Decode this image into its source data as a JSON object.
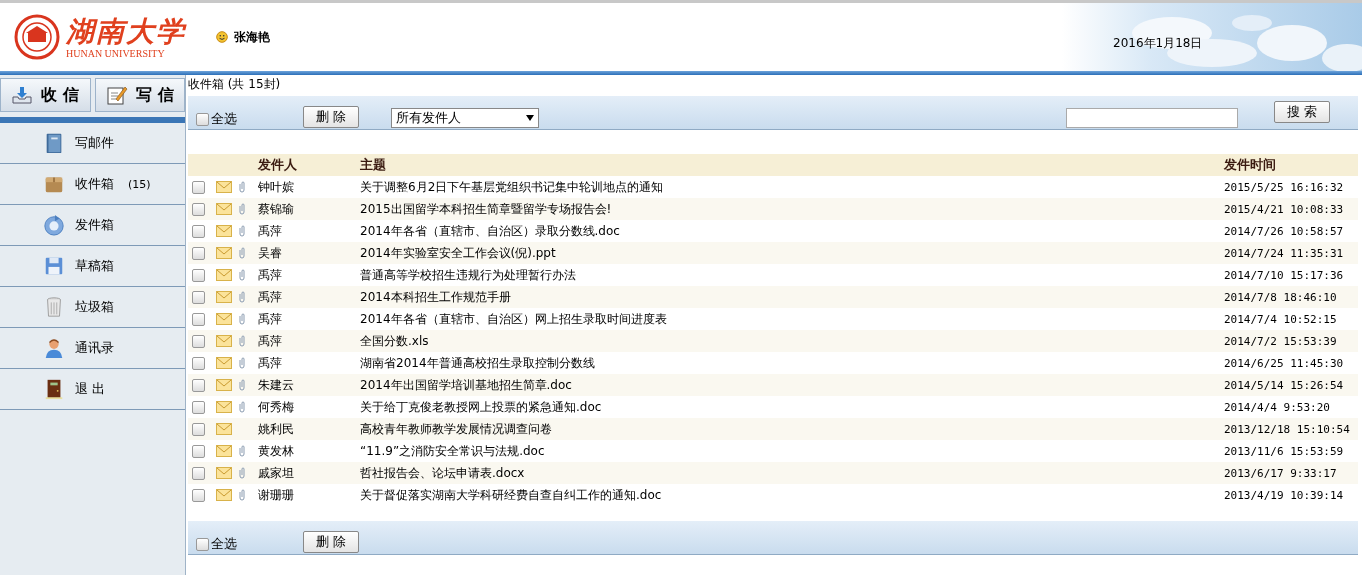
{
  "header": {
    "logo_name": "湖南大学",
    "logo_english": "HUNAN UNIVERSITY",
    "user": "张海艳",
    "date": "2016年1月18日"
  },
  "sidebar": {
    "buttons": [
      {
        "label": "收 信"
      },
      {
        "label": "写 信"
      }
    ],
    "items": [
      {
        "label": "写邮件"
      },
      {
        "label": "收件箱",
        "count": "(15)"
      },
      {
        "label": "发件箱"
      },
      {
        "label": "草稿箱"
      },
      {
        "label": "垃圾箱"
      },
      {
        "label": "通讯录"
      },
      {
        "label": "退 出"
      }
    ]
  },
  "main": {
    "title": "收件箱 (共 15封)",
    "toolbar": {
      "select_all": "全选",
      "select_all_checked": false,
      "delete": "删 除",
      "sender_filter": "所有发件人",
      "search_button": "搜 索"
    },
    "columns": [
      "发件人",
      "主题",
      "发件时间"
    ],
    "rows": [
      {
        "checked": false,
        "attachment": true,
        "sender": "钟叶嫔",
        "subject": "关于调整6月2日下午基层党组织书记集中轮训地点的通知",
        "time": "2015/5/25 16:16:32"
      },
      {
        "checked": false,
        "attachment": true,
        "sender": "蔡锦瑜",
        "subject": "2015出国留学本科招生简章暨留学专场报告会!",
        "time": "2015/4/21 10:08:33"
      },
      {
        "checked": false,
        "attachment": true,
        "sender": "禹萍",
        "subject": "2014年各省（直辖市、自治区）录取分数线.doc",
        "time": "2014/7/26 10:58:57"
      },
      {
        "checked": false,
        "attachment": true,
        "sender": "吴睿",
        "subject": "2014年实验室安全工作会议(倪).ppt",
        "time": "2014/7/24 11:35:31"
      },
      {
        "checked": false,
        "attachment": true,
        "sender": "禹萍",
        "subject": "普通高等学校招生违规行为处理暂行办法",
        "time": "2014/7/10 15:17:36"
      },
      {
        "checked": false,
        "attachment": true,
        "sender": "禹萍",
        "subject": "2014本科招生工作规范手册",
        "time": "2014/7/8 18:46:10"
      },
      {
        "checked": false,
        "attachment": true,
        "sender": "禹萍",
        "subject": "2014年各省（直辖市、自治区）网上招生录取时间进度表",
        "time": "2014/7/4 10:52:15"
      },
      {
        "checked": false,
        "attachment": true,
        "sender": "禹萍",
        "subject": "全国分数.xls",
        "time": "2014/7/2 15:53:39"
      },
      {
        "checked": false,
        "attachment": true,
        "sender": "禹萍",
        "subject": "湖南省2014年普通高校招生录取控制分数线",
        "time": "2014/6/25 11:45:30"
      },
      {
        "checked": false,
        "attachment": true,
        "sender": "朱建云",
        "subject": "2014年出国留学培训基地招生简章.doc",
        "time": "2014/5/14 15:26:54"
      },
      {
        "checked": false,
        "attachment": true,
        "sender": "何秀梅",
        "subject": "关于给丁克俊老教授网上投票的紧急通知.doc",
        "time": "2014/4/4 9:53:20"
      },
      {
        "checked": false,
        "attachment": false,
        "sender": "姚利民",
        "subject": "高校青年教师教学发展情况调查问卷",
        "time": "2013/12/18 15:10:54"
      },
      {
        "checked": false,
        "attachment": true,
        "sender": "黄发林",
        "subject": "“11.9”之消防安全常识与法规.doc",
        "time": "2013/11/6 15:53:59"
      },
      {
        "checked": false,
        "attachment": true,
        "sender": "戚家坦",
        "subject": "哲社报告会、论坛申请表.docx",
        "time": "2013/6/17 9:33:17"
      },
      {
        "checked": false,
        "attachment": true,
        "sender": "谢珊珊",
        "subject": "关于督促落实湖南大学科研经费自查自纠工作的通知.doc",
        "time": "2013/4/19 10:39:14"
      }
    ],
    "footer": {
      "select_all": "全选",
      "select_all_checked": false,
      "delete": "删 除"
    }
  }
}
